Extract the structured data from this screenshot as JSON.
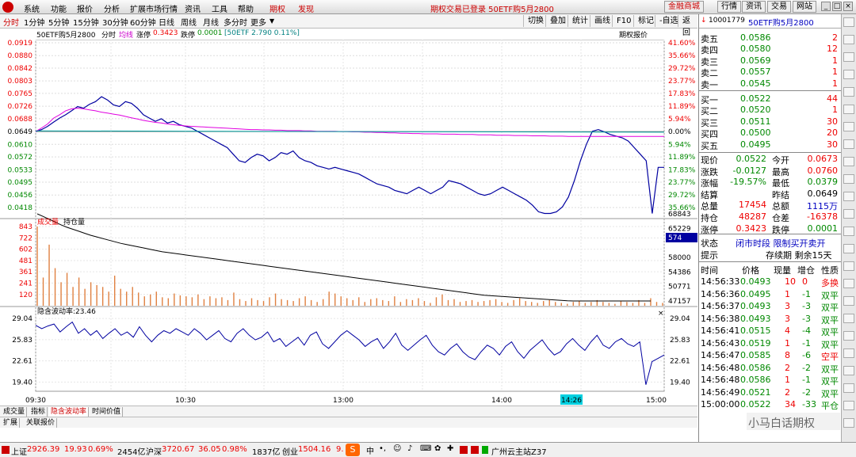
{
  "menubar": {
    "items": [
      "系统",
      "功能",
      "报价",
      "分析",
      "扩展市场行情",
      "资讯",
      "工具",
      "帮助",
      "期权",
      "发现"
    ],
    "center_text": "期权交易已登录  50ETF购5月2800",
    "right_buttons": [
      "金融商城",
      "行情",
      "资讯",
      "交易",
      "网站"
    ]
  },
  "tabbar": {
    "periods": [
      "分时",
      "1分钟",
      "5分钟",
      "15分钟",
      "30分钟",
      "60分钟",
      "日线",
      "周线",
      "月线",
      "多分时",
      "更多"
    ],
    "tools": [
      "切换",
      "叠加",
      "统计",
      "画线",
      "F10",
      "标记",
      "-自选",
      "返回"
    ]
  },
  "infoline": {
    "name": "50ETF购5月2800",
    "mode": "分时",
    "avg_label": "均线",
    "zhangting_label": "涨停",
    "zhangting_value": "0.3423",
    "dieting_label": "跌停",
    "dieting_value": "0.0001",
    "underlying": "[50ETF 2.790 0.11%]",
    "right": "期权报价"
  },
  "chart_data": {
    "type": "line",
    "price_axis": {
      "left": [
        "0.0919",
        "0.0880",
        "0.0842",
        "0.0803",
        "0.0765",
        "0.0726",
        "0.0688",
        "0.0649",
        "0.0610",
        "0.0572",
        "0.0533",
        "0.0495",
        "0.0456",
        "0.0418"
      ],
      "right": [
        "41.60%",
        "35.66%",
        "29.72%",
        "23.77%",
        "17.83%",
        "11.89%",
        "5.94%",
        "0.00%",
        "5.94%",
        "11.89%",
        "17.83%",
        "23.77%",
        "29.72%",
        "35.66%"
      ],
      "prev_close": 0.0649
    },
    "volume_axis": {
      "left": [
        "843",
        "722",
        "602",
        "481",
        "361",
        "241",
        "120"
      ],
      "right": [
        "68843",
        "65229",
        "58000",
        "54386",
        "50771",
        "47157"
      ],
      "current_marker": "574",
      "label_volume": "成交量",
      "label_oi": "持仓量"
    },
    "iv_axis": {
      "label": "隐含波动率:23.46",
      "values": [
        "29.04",
        "25.83",
        "22.61",
        "19.40"
      ]
    },
    "time_axis": [
      "09:30",
      "10:30",
      "13:00",
      "14:00",
      "15:00"
    ],
    "cursor_time": "14:26",
    "price_series": [
      0.0649,
      0.0655,
      0.0665,
      0.0678,
      0.069,
      0.07,
      0.0712,
      0.0725,
      0.072,
      0.0732,
      0.074,
      0.0755,
      0.0745,
      0.073,
      0.0725,
      0.074,
      0.0735,
      0.072,
      0.07,
      0.069,
      0.068,
      0.0688,
      0.0675,
      0.068,
      0.067,
      0.0665,
      0.066,
      0.065,
      0.064,
      0.063,
      0.062,
      0.061,
      0.06,
      0.058,
      0.056,
      0.0555,
      0.057,
      0.058,
      0.0575,
      0.056,
      0.057,
      0.0585,
      0.058,
      0.059,
      0.057,
      0.056,
      0.0555,
      0.0545,
      0.054,
      0.0535,
      0.054,
      0.0535,
      0.053,
      0.0525,
      0.052,
      0.051,
      0.05,
      0.049,
      0.0485,
      0.048,
      0.047,
      0.0465,
      0.046,
      0.047,
      0.048,
      0.047,
      0.046,
      0.047,
      0.048,
      0.05,
      0.0495,
      0.049,
      0.048,
      0.047,
      0.046,
      0.0455,
      0.046,
      0.047,
      0.048,
      0.047,
      0.046,
      0.045,
      0.044,
      0.0425,
      0.0405,
      0.04,
      0.04,
      0.0405,
      0.042,
      0.045,
      0.05,
      0.056,
      0.061,
      0.065,
      0.0655,
      0.0648,
      0.064,
      0.0635,
      0.063,
      0.062,
      0.06,
      0.058,
      0.056,
      0.04,
      0.054,
      0.054
    ],
    "avg_series": [
      0.0649,
      0.066,
      0.0672,
      0.069,
      0.07,
      0.0712,
      0.0718,
      0.072,
      0.0718,
      0.0715,
      0.0712,
      0.0708,
      0.0705,
      0.0702,
      0.0699,
      0.0695,
      0.0691,
      0.0687,
      0.0683,
      0.068,
      0.0677,
      0.0675,
      0.0672,
      0.067,
      0.0668,
      0.0666,
      0.0665,
      0.0664,
      0.0663,
      0.0662,
      0.0661,
      0.066,
      0.0659,
      0.0658,
      0.0657,
      0.0656,
      0.0655,
      0.0655,
      0.0654,
      0.0654,
      0.0653,
      0.0653,
      0.0652,
      0.0652,
      0.0652,
      0.0651,
      0.0651,
      0.065,
      0.065,
      0.065,
      0.065,
      0.0649,
      0.0649,
      0.0648,
      0.0648,
      0.0647,
      0.0647,
      0.0646,
      0.0646,
      0.0645,
      0.0645,
      0.0644,
      0.0644,
      0.0643,
      0.0643,
      0.0642,
      0.0642,
      0.0642,
      0.0641,
      0.0641,
      0.0641,
      0.064,
      0.064,
      0.064,
      0.0639,
      0.0639,
      0.0639,
      0.0638,
      0.0638,
      0.0638,
      0.0637,
      0.0637,
      0.0637,
      0.0636,
      0.0636,
      0.0636,
      0.0635,
      0.0635,
      0.0635,
      0.0634,
      0.0634,
      0.0634,
      0.0634,
      0.0634,
      0.0634,
      0.0634,
      0.0634,
      0.0634,
      0.0634,
      0.0634,
      0.0634,
      0.0634,
      0.0634,
      0.0634,
      0.0634,
      0.0634
    ],
    "volume_series": [
      843,
      300,
      650,
      400,
      250,
      350,
      200,
      300,
      180,
      250,
      220,
      200,
      150,
      320,
      180,
      150,
      200,
      140,
      100,
      120,
      150,
      90,
      80,
      130,
      110,
      100,
      90,
      120,
      70,
      100,
      80,
      90,
      60,
      140,
      70,
      50,
      80,
      60,
      50,
      90,
      130,
      70,
      60,
      50,
      80,
      100,
      60,
      40,
      70,
      150,
      130,
      100,
      80,
      60,
      90,
      40,
      70,
      80,
      60,
      50,
      100,
      40,
      70,
      60,
      80,
      50,
      30,
      90,
      120,
      60,
      70,
      40,
      50,
      60,
      40,
      50,
      60,
      70,
      40,
      30,
      60,
      80,
      50,
      40,
      30,
      50,
      60,
      40,
      30,
      20,
      40,
      50,
      30,
      40,
      60,
      40,
      30,
      20,
      50,
      40,
      30,
      60,
      30,
      80,
      40,
      30
    ],
    "oi_series": [
      68843,
      68200,
      67500,
      66800,
      66100,
      65500,
      65000,
      64500,
      64000,
      63500,
      63100,
      62700,
      62300,
      61900,
      61500,
      61200,
      60900,
      60600,
      60300,
      60000,
      59700,
      59400,
      59200,
      59000,
      58800,
      58600,
      58400,
      58200,
      58000,
      57800,
      57600,
      57400,
      57200,
      57000,
      56800,
      56600,
      56400,
      56200,
      56000,
      55800,
      55600,
      55400,
      55200,
      55000,
      54800,
      54600,
      54400,
      54200,
      54000,
      53800,
      53600,
      53400,
      53200,
      53000,
      52800,
      52600,
      52400,
      52200,
      52000,
      51800,
      51600,
      51400,
      51200,
      51000,
      50800,
      50600,
      50400,
      50200,
      50000,
      49800,
      49600,
      49400,
      49200,
      49000,
      48800,
      48600,
      48500,
      48400,
      48300,
      48200,
      48100,
      48000,
      47900,
      47800,
      47700,
      47600,
      47500,
      47400,
      47300,
      47200,
      47157,
      47157,
      47157,
      47157,
      47157,
      47157,
      47157,
      47157,
      47157,
      47157,
      47157,
      47157,
      47157,
      47157
    ],
    "iv_series": [
      28.0,
      27.5,
      27.9,
      28.2,
      27.0,
      27.8,
      28.5,
      26.8,
      27.5,
      26.5,
      27.2,
      26.0,
      26.8,
      27.5,
      26.5,
      27.0,
      26.2,
      27.8,
      26.5,
      25.5,
      26.5,
      27.2,
      26.8,
      27.5,
      27.0,
      26.5,
      27.5,
      26.8,
      25.8,
      26.5,
      27.2,
      26.0,
      25.5,
      26.8,
      27.5,
      26.5,
      25.8,
      26.2,
      27.0,
      25.5,
      26.0,
      24.8,
      25.5,
      26.2,
      25.0,
      26.5,
      27.0,
      25.2,
      24.5,
      25.5,
      26.5,
      27.2,
      26.5,
      25.8,
      24.8,
      25.5,
      26.0,
      24.5,
      25.5,
      26.8,
      25.0,
      24.2,
      25.0,
      25.8,
      26.5,
      25.0,
      24.0,
      23.5,
      24.5,
      25.2,
      24.0,
      23.2,
      22.8,
      24.0,
      25.0,
      24.5,
      23.5,
      24.8,
      25.5,
      24.0,
      23.0,
      24.2,
      25.0,
      25.8,
      24.5,
      23.5,
      24.0,
      25.2,
      26.0,
      25.0,
      24.2,
      25.5,
      26.5,
      25.0,
      24.5,
      25.5,
      26.0,
      25.2,
      24.8,
      25.5,
      19.0,
      22.5,
      23.0,
      23.5
    ]
  },
  "bottom_tabs": {
    "row1": [
      "成交量",
      "指标",
      "隐含波动率",
      "时间价值"
    ],
    "row2": [
      "扩展",
      "关联报价"
    ]
  },
  "panel": {
    "code": "10001779",
    "name": "50ETF购5月2800",
    "asks": [
      {
        "label": "卖五",
        "price": "0.0586",
        "vol": "2"
      },
      {
        "label": "卖四",
        "price": "0.0580",
        "vol": "12"
      },
      {
        "label": "卖三",
        "price": "0.0569",
        "vol": "1"
      },
      {
        "label": "卖二",
        "price": "0.0557",
        "vol": "1"
      },
      {
        "label": "卖一",
        "price": "0.0545",
        "vol": "1"
      }
    ],
    "bids": [
      {
        "label": "买一",
        "price": "0.0522",
        "vol": "44"
      },
      {
        "label": "买二",
        "price": "0.0520",
        "vol": "1"
      },
      {
        "label": "买三",
        "price": "0.0511",
        "vol": "30"
      },
      {
        "label": "买四",
        "price": "0.0500",
        "vol": "20"
      },
      {
        "label": "买五",
        "price": "0.0495",
        "vol": "30"
      }
    ],
    "stats": [
      {
        "l1": "现价",
        "v1": "0.0522",
        "l2": "今开",
        "v2": "0.0673"
      },
      {
        "l1": "涨跌",
        "v1": "-0.0127",
        "l2": "最高",
        "v2": "0.0760"
      },
      {
        "l1": "涨幅",
        "v1": "-19.57%",
        "l2": "最低",
        "v2": "0.0379"
      },
      {
        "l1": "结算",
        "v1": "",
        "l2": "昨结",
        "v2": "0.0649"
      },
      {
        "l1": "总量",
        "v1": "17454",
        "l2": "总额",
        "v2": "1115万"
      },
      {
        "l1": "持仓",
        "v1": "48287",
        "l2": "仓差",
        "v2": "-16378"
      },
      {
        "l1": "涨停",
        "v1": "0.3423",
        "l2": "跌停",
        "v2": "0.0001"
      }
    ],
    "status_label": "状态",
    "status_value": "闭市时段 限制买开卖开",
    "tip_label": "提示",
    "tip_value": "存续期 剩余15天",
    "trade_headers": [
      "时间",
      "价格",
      "现量",
      "增仓",
      "性质"
    ],
    "trades": [
      {
        "time": "14:56:33",
        "price": "0.0493",
        "vol": "10",
        "oi": "0",
        "type": "多换"
      },
      {
        "time": "14:56:36",
        "price": "0.0495",
        "vol": "1",
        "oi": "-1",
        "type": "双平"
      },
      {
        "time": "14:56:37",
        "price": "0.0493",
        "vol": "3",
        "oi": "-3",
        "type": "双平"
      },
      {
        "time": "14:56:38",
        "price": "0.0493",
        "vol": "3",
        "oi": "-3",
        "type": "双平"
      },
      {
        "time": "14:56:41",
        "price": "0.0515",
        "vol": "4",
        "oi": "-4",
        "type": "双平"
      },
      {
        "time": "14:56:43",
        "price": "0.0519",
        "vol": "1",
        "oi": "-1",
        "type": "双平"
      },
      {
        "time": "14:56:47",
        "price": "0.0585",
        "vol": "8",
        "oi": "-6",
        "type": "空平"
      },
      {
        "time": "14:56:48",
        "price": "0.0586",
        "vol": "2",
        "oi": "-2",
        "type": "双平"
      },
      {
        "time": "14:56:48",
        "price": "0.0586",
        "vol": "1",
        "oi": "-1",
        "type": "双平"
      },
      {
        "time": "14:56:49",
        "price": "0.0521",
        "vol": "2",
        "oi": "-2",
        "type": "双平"
      },
      {
        "time": "15:00:00",
        "price": "0.0522",
        "vol": "34",
        "oi": "-33",
        "type": "平仓"
      }
    ],
    "footer": "小马白话期权"
  },
  "statusbar": {
    "sh_label": "上证",
    "sh_value": "2926.39",
    "sh_chg": "19.93",
    "sh_pct": "0.69%",
    "sh_amt": "2454亿",
    "hs_label": "沪深",
    "hs_value": "3720.67",
    "hs_chg": "36.05",
    "hs_pct": "0.98%",
    "hs_amt": "1837亿",
    "cy_label": "创业",
    "cy_value": "1504.16",
    "cy_extra": "9.",
    "server": "广州云主站Z37"
  }
}
